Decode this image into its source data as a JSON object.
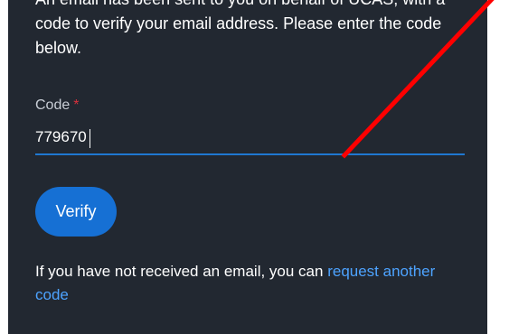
{
  "verification": {
    "intro_text": "An email has been sent to you on behalf of UCAS, with a code to verify your email address. Please enter the code below.",
    "code_label": "Code",
    "required_marker": "*",
    "code_value": "779670",
    "verify_label": "Verify",
    "resend_prefix": "If you have not received an email, you can ",
    "resend_link": "request another code"
  },
  "colors": {
    "panel_background": "#222831",
    "accent_blue": "#1670d4",
    "link_blue": "#4da3ff",
    "required_red": "#d8303c",
    "annotation_red": "#ff0000"
  }
}
